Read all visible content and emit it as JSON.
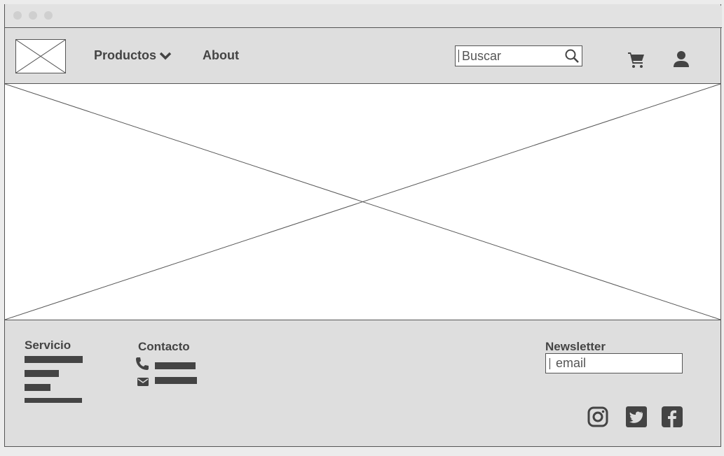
{
  "navbar": {
    "products_label": "Productos",
    "about_label": "About",
    "search_placeholder": "Buscar"
  },
  "footer": {
    "service_heading": "Servicio",
    "contact_heading": "Contacto",
    "newsletter_heading": "Newsletter",
    "email_placeholder": "email"
  },
  "icons": {
    "cart": "cart-icon",
    "user": "user-icon",
    "search": "search-icon",
    "phone": "phone-icon",
    "mail": "mail-icon",
    "instagram": "instagram-icon",
    "twitter": "twitter-icon",
    "facebook": "facebook-icon"
  },
  "colors": {
    "chrome": "#dedede",
    "ink": "#444444",
    "border": "#555555"
  }
}
